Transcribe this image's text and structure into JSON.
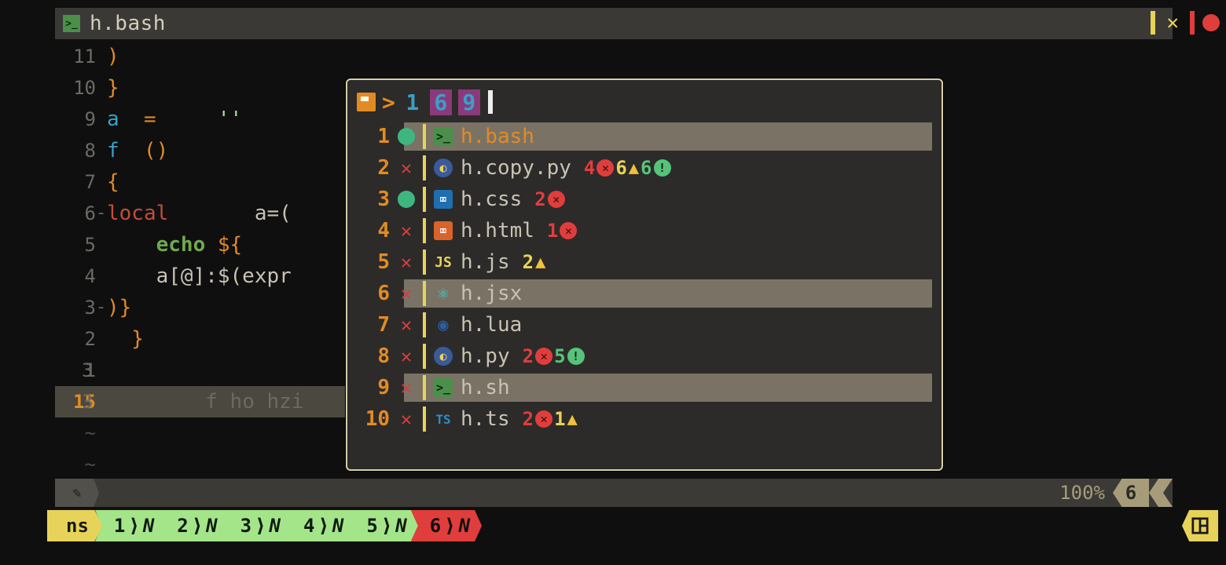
{
  "title": "h.bash",
  "window": {
    "modified_flag": "|",
    "close": "✕",
    "rec": "●"
  },
  "abs_col_marks": [
    "3",
    "3"
  ],
  "gutter": [
    "11",
    "10",
    "9",
    "8",
    "7",
    "6",
    "5",
    "4",
    "3",
    "2",
    "1",
    "15"
  ],
  "code": {
    "l0": ")",
    "l1": "}",
    "l2_a": "a",
    "l2_eq": "  =     ",
    "l2_q": "''",
    "l3_f": "f",
    "l3_p": "  ()",
    "l4": "{",
    "l5_kw": "local",
    "l5_rest": "       a=(",
    "l6_pre": "    ",
    "l6_kw": "echo",
    "l6_rest": " ${",
    "l7": "    a[@]:$(expr",
    "l8": ")}",
    "l9": "  }",
    "l10": "",
    "l11_pre": "        ",
    "l11_call": "f ho hzi",
    "tilde": "~"
  },
  "picker": {
    "query_nums": [
      "1",
      "6",
      "9"
    ],
    "items": [
      {
        "idx": "1",
        "mark": "dot",
        "icon": "term",
        "name": "h.bash",
        "selected": true
      },
      {
        "idx": "2",
        "mark": "x",
        "icon": "py",
        "name": "h.copy.py",
        "diags": [
          [
            "4",
            "r",
            "x"
          ],
          [
            "6",
            "y",
            "tri"
          ],
          [
            "6",
            "g",
            "!"
          ]
        ]
      },
      {
        "idx": "3",
        "mark": "dot",
        "icon": "css",
        "name": "h.css",
        "diags": [
          [
            "2",
            "r",
            "x"
          ]
        ]
      },
      {
        "idx": "4",
        "mark": "x",
        "icon": "html",
        "name": "h.html",
        "diags": [
          [
            "1",
            "r",
            "x"
          ]
        ]
      },
      {
        "idx": "5",
        "mark": "x",
        "icon": "js",
        "name": "h.js",
        "diags": [
          [
            "2",
            "y",
            "tri"
          ]
        ]
      },
      {
        "idx": "6",
        "mark": "x",
        "icon": "jsx",
        "name": "h.jsx",
        "selrow": true
      },
      {
        "idx": "7",
        "mark": "x",
        "icon": "lua",
        "name": "h.lua"
      },
      {
        "idx": "8",
        "mark": "x",
        "icon": "py",
        "name": "h.py",
        "diags": [
          [
            "2",
            "r",
            "x"
          ],
          [
            "5",
            "g",
            "!"
          ]
        ]
      },
      {
        "idx": "9",
        "mark": "x",
        "icon": "term",
        "name": "h.sh",
        "selrow": true
      },
      {
        "idx": "10",
        "mark": "x",
        "icon": "ts",
        "name": "h.ts",
        "diags": [
          [
            "2",
            "r",
            "x"
          ],
          [
            "1",
            "y",
            "tri"
          ]
        ]
      }
    ]
  },
  "status": {
    "percent": "100%",
    "col": "6"
  },
  "tabs": {
    "session": "ns",
    "items": [
      {
        "n": "1",
        "active": false
      },
      {
        "n": "2",
        "active": false
      },
      {
        "n": "3",
        "active": false
      },
      {
        "n": "4",
        "active": false
      },
      {
        "n": "5",
        "active": false
      },
      {
        "n": "6",
        "active": true
      }
    ]
  }
}
